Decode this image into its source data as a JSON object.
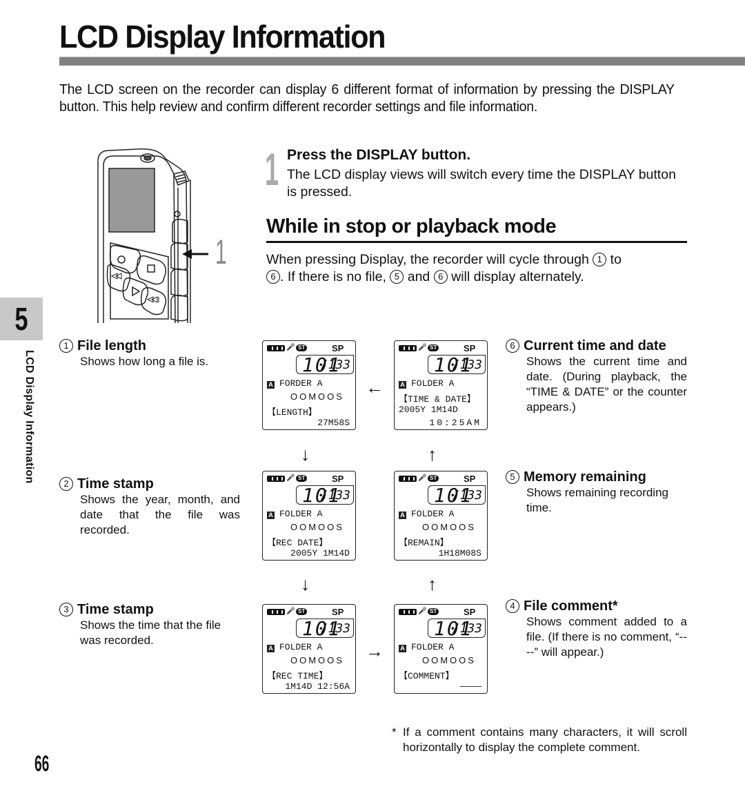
{
  "page": {
    "title": "LCD Display Information",
    "intro": "The LCD screen on the recorder can display 6 different format of information by pressing the DISPLAY button. This help review and confirm different recorder settings and file information.",
    "chapter_number": "5",
    "chapter_label": "LCD Display Information",
    "page_number": "66"
  },
  "step": {
    "number": "1",
    "title": "Press the DISPLAY button.",
    "description": "The LCD display views will switch every time the DISPLAY button is pressed."
  },
  "device_callout": "1",
  "section": {
    "heading": "While in stop or playback mode",
    "text_parts": [
      "When pressing Display, the recorder will cycle through ",
      "1",
      " to ",
      "6",
      ". If there is no file, ",
      "5",
      " and ",
      "6",
      " will display alternately."
    ]
  },
  "items": [
    {
      "num": "1",
      "title": "File length",
      "desc": "Shows how long a file is."
    },
    {
      "num": "2",
      "title": "Time stamp",
      "desc": "Shows the year, month, and date that the file was recorded."
    },
    {
      "num": "3",
      "title": "Time stamp",
      "desc": "Shows the time that the file was recorded."
    },
    {
      "num": "4",
      "title": "File comment*",
      "desc": "Shows comment added to a file. (If there is no comment, “----” will appear.)"
    },
    {
      "num": "5",
      "title": "Memory remaining",
      "desc": "Shows remaining recording time."
    },
    {
      "num": "6",
      "title": "Current time and date",
      "desc": "Shows the current time and date. (During playback, the “TIME & DATE” or the counter appears.)"
    }
  ],
  "lcd_common": {
    "mic": "H",
    "st": "ST",
    "mode": "SP",
    "counter": "101",
    "total": "/133",
    "folder_icon": "A"
  },
  "lcds": [
    {
      "folder": "FORDER A",
      "line2": "OOMOOS",
      "label": "【LENGTH】",
      "value": "27M58S"
    },
    {
      "folder": "FOLDER A",
      "line2": "OOMOOS",
      "label": "【REC DATE】",
      "value": "2005Y 1M14D"
    },
    {
      "folder": "FOLDER A",
      "line2": "OOMOOS",
      "label": "【REC TIME】",
      "value": "1M14D 12:56A"
    },
    {
      "folder": "FOLDER A",
      "line2": "OOMOOS",
      "label": "【COMMENT】",
      "value": "————"
    },
    {
      "folder": "FOLDER A",
      "line2": "OOMOOS",
      "label": "【REMAIN】",
      "value": "1H18M08S"
    },
    {
      "folder": "FOLDER A",
      "line2": "【TIME & DATE】",
      "label": "2005Y 1M14D",
      "value": "10:25AM"
    }
  ],
  "arrows": {
    "down": "↓",
    "up": "↑",
    "left": "←",
    "right": "→"
  },
  "footnote": {
    "star": "*",
    "text": "If a comment contains many characters, it will scroll horizontally to display the complete comment."
  }
}
